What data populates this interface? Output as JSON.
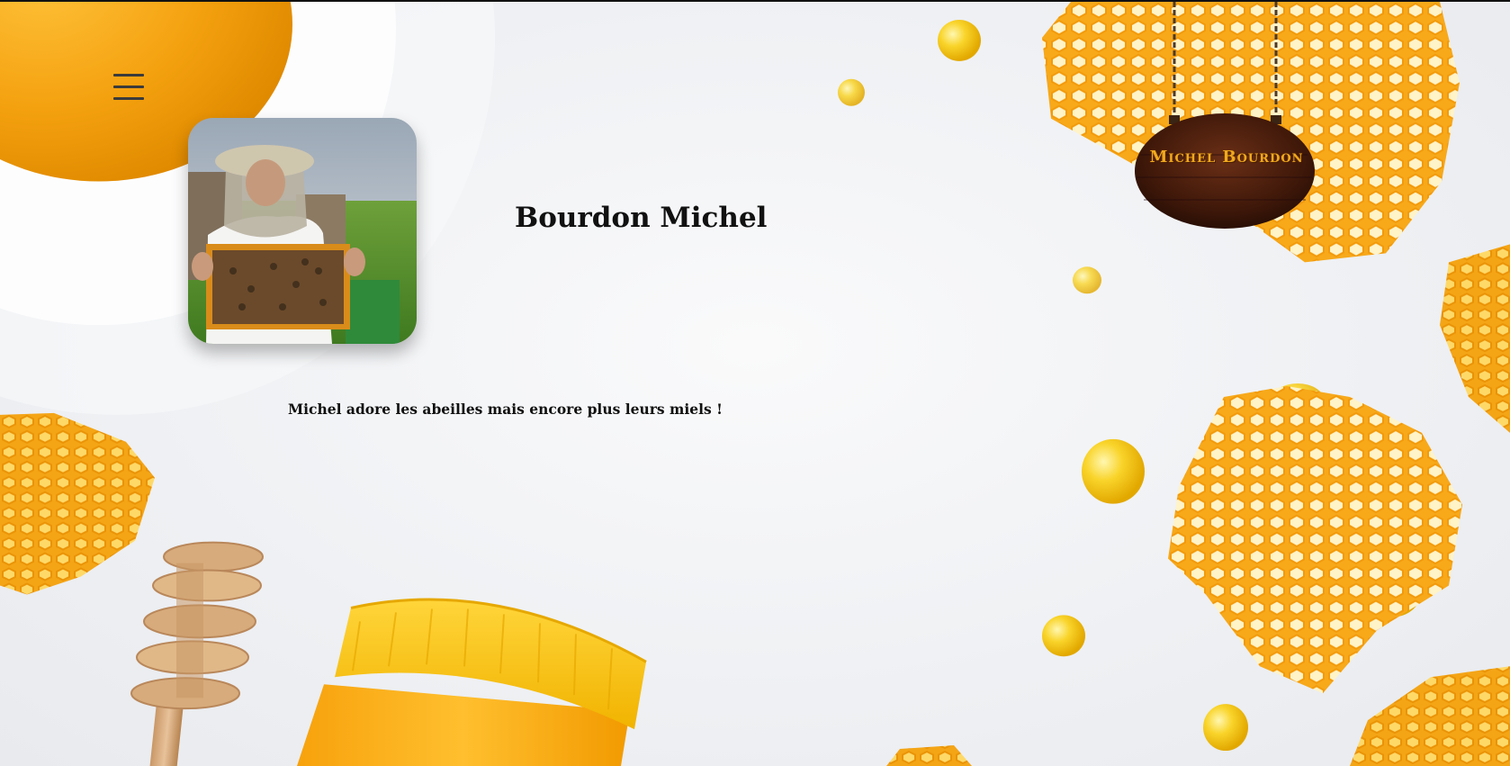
{
  "profile": {
    "name": "Bourdon Michel",
    "bio": "Michel adore les abeilles mais encore plus leurs miels !"
  },
  "sign": {
    "text": "Michel Bourdon"
  },
  "icons": {
    "menu": "hamburger-menu-icon"
  },
  "colors": {
    "honey": "#f5a316",
    "honey_light": "#ffcf3d",
    "wood_dark": "#3a1a0c",
    "text": "#111111"
  }
}
